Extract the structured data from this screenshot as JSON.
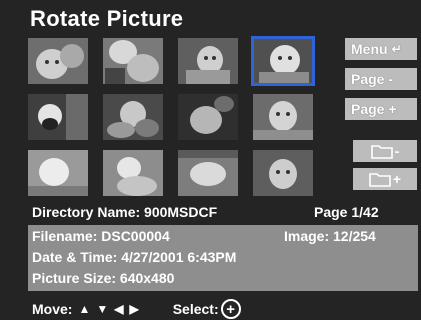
{
  "screen": {
    "title": "Rotate Picture"
  },
  "thumbnails": [
    {
      "name": "thumb-1",
      "tone": "#8a8a8a"
    },
    {
      "name": "thumb-2",
      "tone": "#9a9a9a"
    },
    {
      "name": "thumb-3",
      "tone": "#7c7c7c"
    },
    {
      "name": "thumb-4",
      "tone": "#a3a3a3",
      "selected": true
    },
    {
      "name": "thumb-5",
      "tone": "#666666"
    },
    {
      "name": "thumb-6",
      "tone": "#6f6f6f"
    },
    {
      "name": "thumb-7",
      "tone": "#5b5b5b"
    },
    {
      "name": "thumb-8",
      "tone": "#8f8f8f"
    },
    {
      "name": "thumb-9",
      "tone": "#b0b0b0"
    },
    {
      "name": "thumb-10",
      "tone": "#9f9f9f"
    },
    {
      "name": "thumb-11",
      "tone": "#8c8c8c"
    },
    {
      "name": "thumb-12",
      "tone": "#7e7e7e"
    }
  ],
  "buttons": {
    "menu": "Menu",
    "page_minus": "Page -",
    "page_plus": "Page +",
    "folder_minus": "-",
    "folder_plus": "+"
  },
  "directory": {
    "label": "Directory Name: 900MSDCF",
    "page": "Page 1/42"
  },
  "info": {
    "filename": "Filename: DSC00004",
    "image": "Image: 12/254",
    "datetime": "Date & Time: 4/27/2001 6:43PM",
    "size": "Picture Size: 640x480"
  },
  "footer": {
    "move_label": "Move:",
    "select_label": "Select:"
  },
  "colors": {
    "selection": "#2f63d6",
    "button_bg": "#bcbcbc",
    "info_bg": "#8e8e8e"
  }
}
